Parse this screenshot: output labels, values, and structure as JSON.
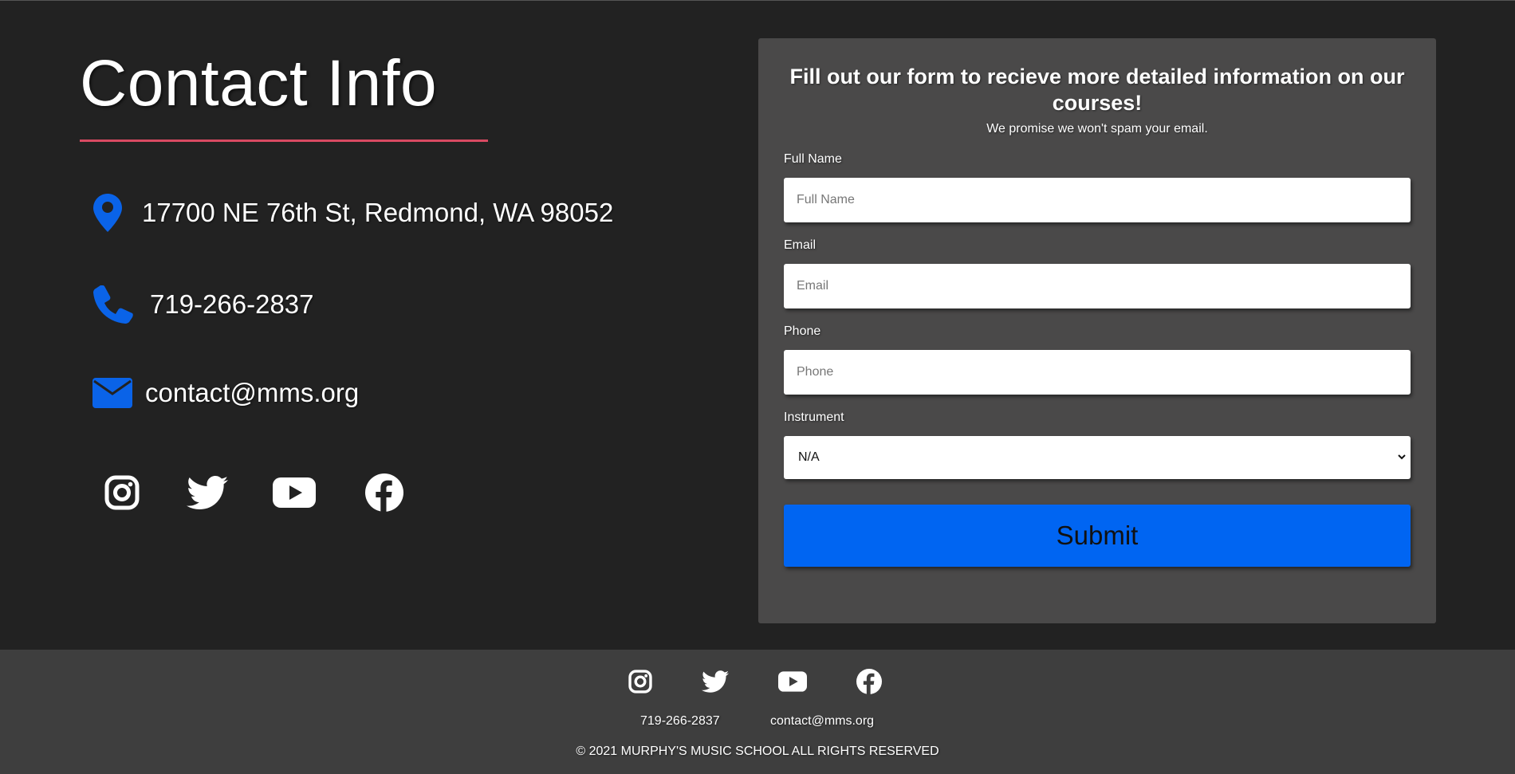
{
  "contact": {
    "title": "Contact Info",
    "address": "17700 NE 76th St, Redmond, WA 98052",
    "phone": "719-266-2837",
    "email": "contact@mms.org",
    "icons": {
      "address": "map-pin-icon",
      "phone": "phone-icon",
      "email": "envelope-icon"
    }
  },
  "social": [
    "instagram-icon",
    "twitter-icon",
    "youtube-icon",
    "facebook-icon"
  ],
  "form": {
    "heading": "Fill out our form to recieve more detailed information on our courses!",
    "subheading": "We promise we won't spam your email.",
    "fields": {
      "full_name": {
        "label": "Full Name",
        "placeholder": "Full Name"
      },
      "email": {
        "label": "Email",
        "placeholder": "Email"
      },
      "phone": {
        "label": "Phone",
        "placeholder": "Phone"
      },
      "instrument": {
        "label": "Instrument",
        "value": "N/A"
      }
    },
    "submit_label": "Submit"
  },
  "footer": {
    "phone": "719-266-2837",
    "email": "contact@mms.org",
    "copyright": "© 2021 MURPHY'S MUSIC SCHOOL ALL RIGHTS RESERVED"
  },
  "colors": {
    "background": "#222222",
    "card": "#4a4949",
    "footer": "#3e3e3e",
    "accent_blue": "#0065f2",
    "title_underline": "#d94a62"
  }
}
